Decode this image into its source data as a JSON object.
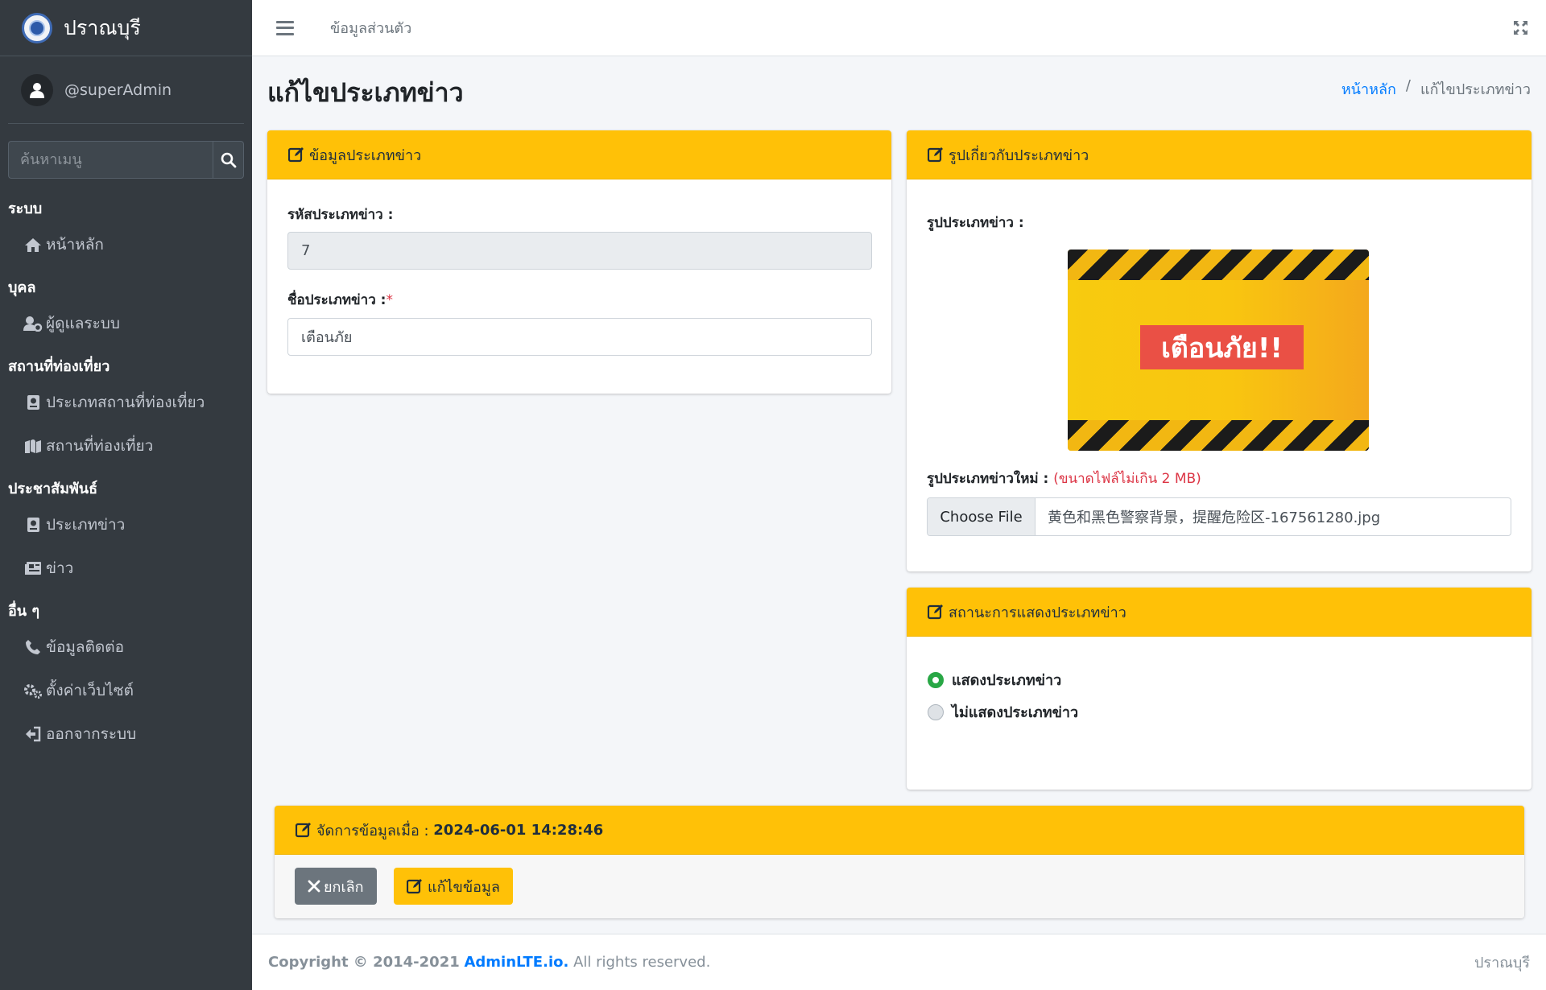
{
  "sidebar": {
    "brand": "ปราณบุรี",
    "user": "@superAdmin",
    "search_placeholder": "ค้นหาเมนู",
    "sections": [
      {
        "header": "ระบบ",
        "items": [
          {
            "label": "หน้าหลัก",
            "icon": "home-icon"
          }
        ]
      },
      {
        "header": "บุคล",
        "items": [
          {
            "label": "ผู้ดูแลระบบ",
            "icon": "user-cog-icon"
          }
        ]
      },
      {
        "header": "สถานที่ท่องเที่ยว",
        "items": [
          {
            "label": "ประเภทสถานที่ท่องเที่ยว",
            "icon": "book-icon"
          },
          {
            "label": "สถานที่ท่องเที่ยว",
            "icon": "map-icon"
          }
        ]
      },
      {
        "header": "ประชาสัมพันธ์",
        "items": [
          {
            "label": "ประเภทข่าว",
            "icon": "book-icon"
          },
          {
            "label": "ข่าว",
            "icon": "newspaper-icon"
          }
        ]
      },
      {
        "header": "อื่น ๆ",
        "items": [
          {
            "label": "ข้อมูลติดต่อ",
            "icon": "phone-icon"
          },
          {
            "label": "ตั้งค่าเว็บไซต์",
            "icon": "cogs-icon"
          },
          {
            "label": "ออกจากระบบ",
            "icon": "sign-out-icon"
          }
        ]
      }
    ]
  },
  "topbar": {
    "link": "ข้อมูลส่วนตัว"
  },
  "page": {
    "title": "แก้ไขประเภทข่าว",
    "breadcrumb": {
      "home": "หน้าหลัก",
      "sep": "/",
      "current": "แก้ไขประเภทข่าว"
    }
  },
  "info_card": {
    "header": "ข้อมูลประเภทข่าว",
    "id_label": "รหัสประเภทข่าว :",
    "id_value": "7",
    "name_label": "ชื่อประเภทข่าว :",
    "required_mark": "*",
    "name_value": "เตือนภัย"
  },
  "image_card": {
    "header": "รูปเกี่ยวกับประเภทข่าว",
    "current_label": "รูปประเภทข่าว :",
    "image_text": "เตือนภัย!!",
    "new_label": "รูปประเภทข่าวใหม่ :",
    "new_hint": "(ขนาดไฟล์ไม่เกิน 2 MB)",
    "choose_file": "Choose File",
    "file_name": "黄色和黑色警察背景，提醒危险区-167561280.jpg"
  },
  "status_card": {
    "header": "สถานะการแสดงประเภทข่าว",
    "options": [
      {
        "label": "แสดงประเภทข่าว",
        "checked": true
      },
      {
        "label": "ไม่แสดงประเภทข่าว",
        "checked": false
      }
    ]
  },
  "manage_card": {
    "header_prefix": "จัดการข้อมูลเมื่อ :",
    "timestamp": "2024-06-01 14:28:46",
    "cancel": "ยกเลิก",
    "save": "แก้ไขข้อมูล"
  },
  "footer": {
    "copyright_prefix": "Copyright © 2014-2021",
    "link": "AdminLTE.io.",
    "suffix": "All rights reserved.",
    "right": "ปราณบุรี"
  },
  "colors": {
    "sidebar": "#343a40",
    "accent": "#ffc107",
    "link": "#007bff",
    "success": "#28a745",
    "danger": "#dc3545"
  }
}
